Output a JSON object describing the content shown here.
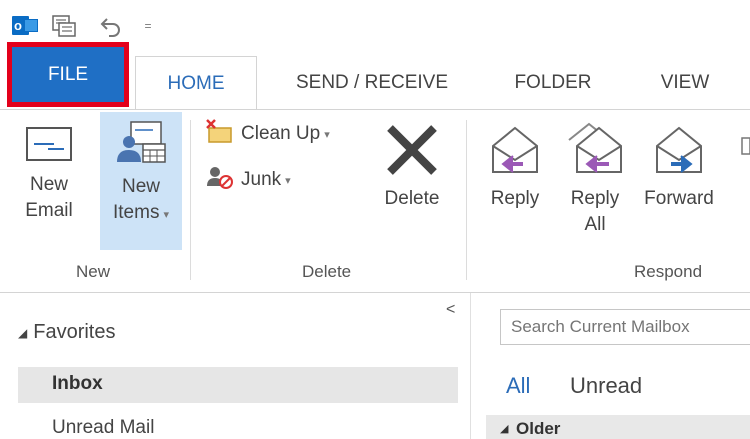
{
  "quick_access": {
    "app_icon": "outlook-icon",
    "app_icon_letter": "o",
    "sync_icon": "send-receive-all-icon",
    "undo_icon": "undo-icon",
    "customize_glyph": "="
  },
  "tabs": [
    {
      "label": "FILE",
      "selected_highlight": true
    },
    {
      "label": "HOME",
      "active": true
    },
    {
      "label": "SEND / RECEIVE"
    },
    {
      "label": "FOLDER"
    },
    {
      "label": "VIEW"
    }
  ],
  "ribbon": {
    "new_email": {
      "line1": "New",
      "line2": "Email",
      "icon": "envelope-icon"
    },
    "new_items": {
      "line1": "New",
      "line2": "Items",
      "icon": "new-items-icon"
    },
    "clean_up": {
      "label": "Clean Up",
      "icon": "clean-up-icon"
    },
    "junk": {
      "label": "Junk",
      "icon": "junk-icon"
    },
    "delete": {
      "label": "Delete",
      "icon": "delete-x-icon"
    },
    "reply": {
      "label": "Reply",
      "icon": "reply-icon"
    },
    "reply_all": {
      "line1": "Reply",
      "line2": "All",
      "icon": "reply-all-icon"
    },
    "forward": {
      "label": "Forward",
      "icon": "forward-icon"
    },
    "groups": {
      "new": "New",
      "delete": "Delete",
      "respond": "Respond"
    }
  },
  "folder_pane": {
    "collapse_glyph": "<",
    "favorites": "Favorites",
    "inbox": "Inbox",
    "unread_mail": "Unread Mail"
  },
  "mail_list": {
    "search_placeholder": "Search Current Mailbox",
    "filter_all": "All",
    "filter_unread": "Unread",
    "group_older": "Older"
  },
  "colors": {
    "accent": "#2b6cb8",
    "file_tab": "#1f6fc5",
    "highlight_box": "#e3001b",
    "selected_button": "#cde3f7"
  }
}
